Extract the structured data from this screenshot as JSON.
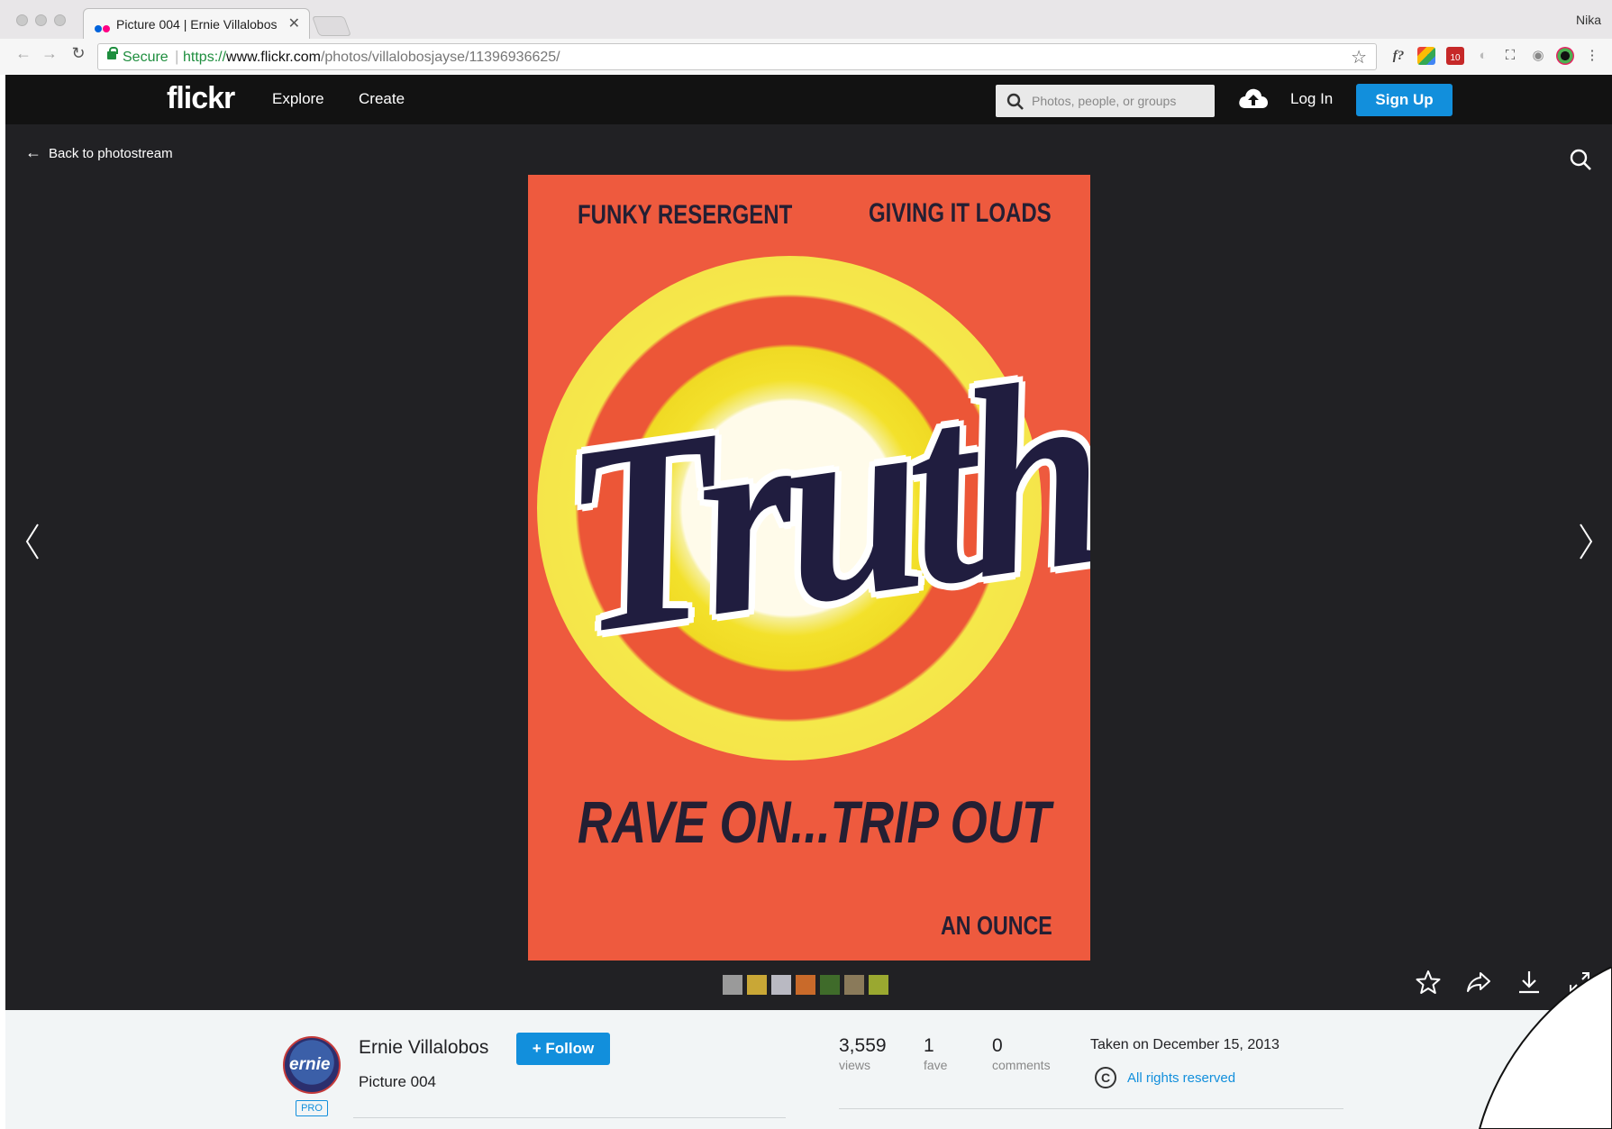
{
  "browser": {
    "tab_title": "Picture 004 | Ernie Villalobos |",
    "profile_name": "Nika",
    "secure_label": "Secure",
    "url_scheme": "https://",
    "url_host": "www.flickr.com",
    "url_path": "/photos/villalobosjayse/11396936625/",
    "extension_badge": "10"
  },
  "header": {
    "logo": "flickr",
    "nav": {
      "explore": "Explore",
      "create": "Create"
    },
    "search_placeholder": "Photos, people, or groups",
    "login": "Log In",
    "signup": "Sign Up"
  },
  "stage": {
    "back_label": "Back to photostream",
    "poster": {
      "top_left": "FUNKY RESERGENT",
      "top_right": "GIVING IT LOADS",
      "logo_word": "Truth",
      "slogan": "RAVE ON...TRIP OUT",
      "bottom_right": "AN OUNCE"
    },
    "thumbnail_colors": [
      "#9a9a9a",
      "#c9a736",
      "#b9b9c2",
      "#c96a2a",
      "#3f6b2a",
      "#8a7a5a",
      "#9aa830"
    ]
  },
  "info": {
    "owner_name": "Ernie Villalobos",
    "avatar_text": "ernie",
    "pro_badge": "PRO",
    "follow_label": "+ Follow",
    "photo_title": "Picture 004",
    "stats": {
      "views_count": "3,559",
      "views_label": "views",
      "faves_count": "1",
      "faves_label": "fave",
      "comments_count": "0",
      "comments_label": "comments"
    },
    "taken": "Taken on December 15, 2013",
    "rights_icon": "C",
    "rights": "All rights reserved"
  },
  "colors": {
    "flickr_blue": "#128fdc",
    "header_bg": "#121212",
    "stage_bg": "#212124",
    "secure_green": "#1e8e3e"
  }
}
